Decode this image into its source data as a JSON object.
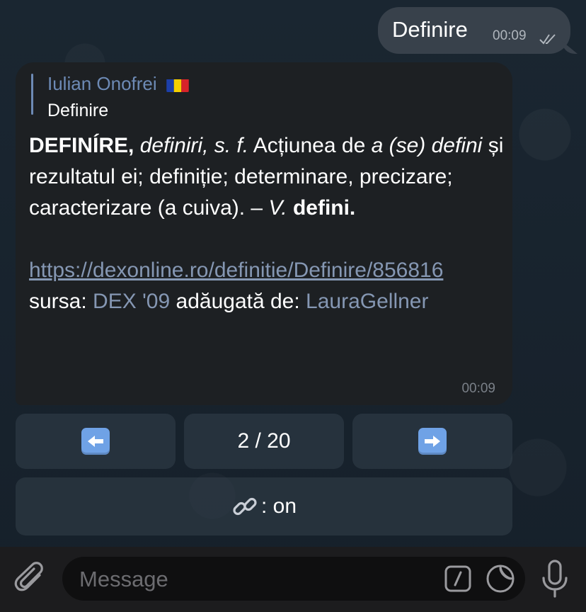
{
  "outgoing": {
    "text": "Definire",
    "time": "00:09"
  },
  "incoming": {
    "reply_author": "Iulian Onofrei",
    "reply_text": "Definire",
    "headword": "DEFINÍRE,",
    "plural": "definiri,",
    "pos": "s. f.",
    "def_part1": "Acțiunea de",
    "def_italic1": "a (se) defini",
    "def_part2": "și rezultatul ei; definiție; determinare, precizare; caracterizare (a cuiva). –",
    "ref_v": "V.",
    "ref_word": "defini.",
    "link": "https://dexonline.ro/definitie/Definire/856816",
    "source_label": "sursa:",
    "source_name": "DEX '09",
    "added_by_label": "adăugată de:",
    "added_by": "LauraGellner",
    "time": "00:09"
  },
  "keyboard": {
    "page": "2 / 20",
    "link_toggle": ": on"
  },
  "input": {
    "placeholder": "Message"
  },
  "colors": {
    "link": "#8597b3",
    "accent": "#6d8ab5",
    "arrow_button": "#6fa2e6"
  }
}
